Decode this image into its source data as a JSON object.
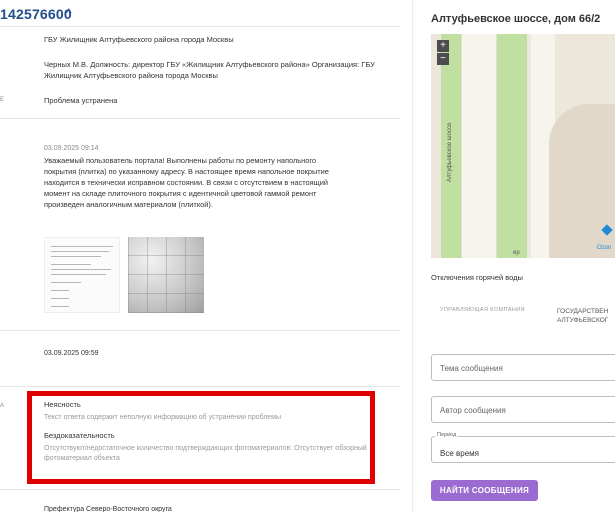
{
  "ticket": {
    "id": "142576600",
    "chevron": "^"
  },
  "rows": {
    "organization": "ГБУ Жилищник Алтуфьевского района города Москвы",
    "responsible": "Черных М.В. Должность: директор ГБУ «Жилищник Алтуфьевского района» Организация: ГБУ Жилищник Алтуфьевского района города Москвы",
    "status_label": "Е",
    "status": "Проблема устранена",
    "answer_date": "03.09.2025 09:14",
    "answer_text": "Уважаемый пользователь портала! Выполнены работы по ремонту напольного покрытия (плитка) по указанному адресу. В настоящее время напольное покрытие находится в технически исправном состоянии. В связи с отсутствием в настоящий момент на складе плиточного покрытия с идентичной цветовой гаммой ремонт произведен аналогичным материалом (плиткой).",
    "closed_date": "03.09.2025 09:59",
    "remarks_label": "А",
    "issues": [
      {
        "title": "Неясность",
        "desc": "Текст ответа содержит неполную информацию об устранении проблемы"
      },
      {
        "title": "Бездоказательность",
        "desc": "Отсутствуют/недостаточное количество подтверждающих фотоматериалов: Отсутствует обзорный фотоматериал объекта"
      }
    ],
    "prefecture": "Префектура Северо-Восточного округа"
  },
  "right": {
    "address": "Алтуфьевское шоссе, дом 66/2",
    "map": {
      "road_label": "Алтуфьевское шоссе",
      "poi": "Ozon",
      "zoom_in": "+",
      "zoom_out": "−",
      "road_fragment": "ер"
    },
    "hot_water": "Отключения горячей воды",
    "uk_label": "УПРАВЛЯЮЩАЯ КОМПАНИЯ",
    "uk_value_1": "ГОСУДАРСТВЕН",
    "uk_value_2": "АЛТУФЬЕВСКОГ",
    "topic_placeholder": "Тема сообщения",
    "author_placeholder": "Автор сообщения",
    "period_label": "Период",
    "period_value": "Все время",
    "search_button": "НАЙТИ СООБЩЕНИЯ"
  },
  "colors": {
    "accent": "#1f4e8c",
    "highlight": "#e00000",
    "button": "#9c6bd1"
  }
}
